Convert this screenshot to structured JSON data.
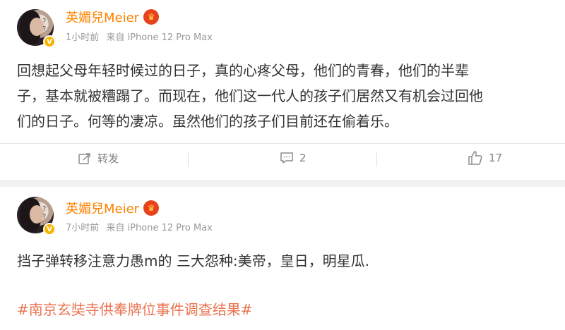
{
  "posts": [
    {
      "username": "英媚兒Meier",
      "time": "1小时前",
      "source": "来自 iPhone 12 Pro Max",
      "text_lines": [
        "回想起父母年轻时候过的日子，真的心疼父母，他们的青春，他们的半辈",
        "子，基本就被糟蹋了。而现在，他们这一代人的孩子们居然又有机会过回他",
        "们的日子。何等的凄凉。虽然他们的孩子们目前还在偷着乐。"
      ],
      "repost_label": "转发",
      "comment_count": "2",
      "like_count": "17"
    },
    {
      "username": "英媚兒Meier",
      "time": "7小时前",
      "source": "来自 iPhone 12 Pro Max",
      "text_lines": [
        "挡子弹转移注意力愚m的 三大怨种:美帝，皇日，明星瓜."
      ],
      "hashtag": "#南京玄奘寺供奉牌位事件调查结果#"
    }
  ],
  "colors": {
    "username": "#ff8200",
    "hashtag": "#eb7350",
    "meta": "#999999",
    "verified_badge": "#f7b500"
  },
  "icons": {
    "verified": "verified-v-icon",
    "member_crown": "crown-icon",
    "repost": "repost-icon",
    "comment": "comment-icon",
    "like": "thumbs-up-icon"
  }
}
